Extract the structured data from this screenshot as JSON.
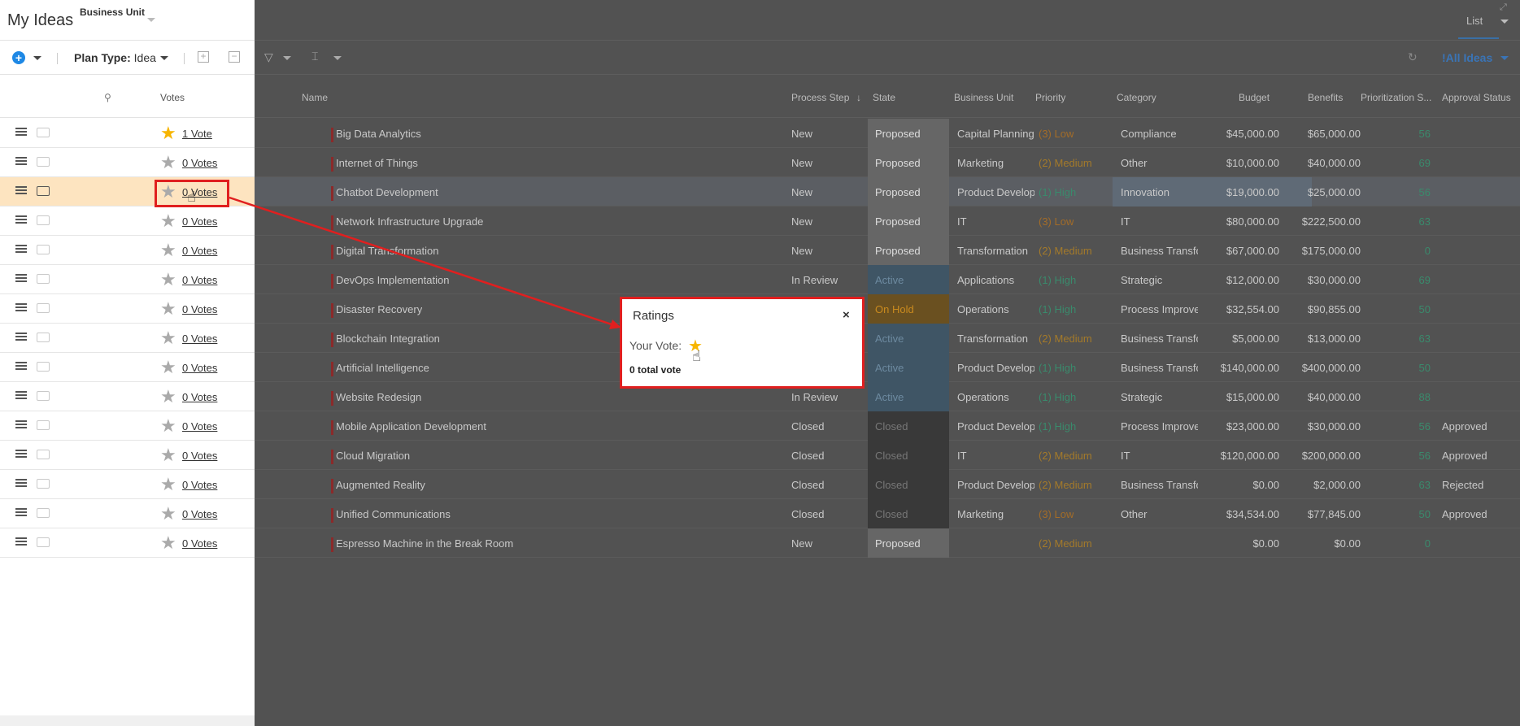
{
  "header": {
    "title": "My Ideas",
    "business_unit_label": "Business Unit",
    "view_tab": "List",
    "view_selector": "!All Ideas"
  },
  "toolbar": {
    "plan_type_label": "Plan Type:",
    "plan_type_value": "Idea"
  },
  "columns": {
    "votes": "Votes",
    "name": "Name",
    "process_step": "Process Step",
    "state": "State",
    "business_unit": "Business Unit",
    "priority": "Priority",
    "category": "Category",
    "budget": "Budget",
    "benefits": "Benefits",
    "prioritization": "Prioritization S...",
    "approval_status": "Approval Status"
  },
  "rows": [
    {
      "votes": "1 Vote",
      "voted": true,
      "name": "Big Data Analytics",
      "step": "New",
      "state": "Proposed",
      "bu": "Capital Planning",
      "priority": "(3) Low",
      "category": "Compliance",
      "budget": "$45,000.00",
      "benefits": "$65,000.00",
      "score": "56",
      "approval": ""
    },
    {
      "votes": "0 Votes",
      "voted": false,
      "name": "Internet of Things",
      "step": "New",
      "state": "Proposed",
      "bu": "Marketing",
      "priority": "(2) Medium",
      "category": "Other",
      "budget": "$10,000.00",
      "benefits": "$40,000.00",
      "score": "69",
      "approval": ""
    },
    {
      "votes": "0 Votes",
      "voted": false,
      "name": "Chatbot Development",
      "step": "New",
      "state": "Proposed",
      "bu": "Product Develop",
      "priority": "(1) High",
      "category": "Innovation",
      "budget": "$19,000.00",
      "benefits": "$25,000.00",
      "score": "56",
      "approval": ""
    },
    {
      "votes": "0 Votes",
      "voted": false,
      "name": "Network Infrastructure Upgrade",
      "step": "New",
      "state": "Proposed",
      "bu": "IT",
      "priority": "(3) Low",
      "category": "IT",
      "budget": "$80,000.00",
      "benefits": "$222,500.00",
      "score": "63",
      "approval": ""
    },
    {
      "votes": "0 Votes",
      "voted": false,
      "name": "Digital Transformation",
      "step": "New",
      "state": "Proposed",
      "bu": "Transformation",
      "priority": "(2) Medium",
      "category": "Business Transfo",
      "budget": "$67,000.00",
      "benefits": "$175,000.00",
      "score": "0",
      "approval": ""
    },
    {
      "votes": "0 Votes",
      "voted": false,
      "name": "DevOps Implementation",
      "step": "In Review",
      "state": "Active",
      "bu": "Applications",
      "priority": "(1) High",
      "category": "Strategic",
      "budget": "$12,000.00",
      "benefits": "$30,000.00",
      "score": "69",
      "approval": ""
    },
    {
      "votes": "0 Votes",
      "voted": false,
      "name": "Disaster Recovery",
      "step": "",
      "state": "On Hold",
      "bu": "Operations",
      "priority": "(1) High",
      "category": "Process Improve",
      "budget": "$32,554.00",
      "benefits": "$90,855.00",
      "score": "50",
      "approval": ""
    },
    {
      "votes": "0 Votes",
      "voted": false,
      "name": "Blockchain Integration",
      "step": "",
      "state": "Active",
      "bu": "Transformation",
      "priority": "(2) Medium",
      "category": "Business Transfo",
      "budget": "$5,000.00",
      "benefits": "$13,000.00",
      "score": "63",
      "approval": ""
    },
    {
      "votes": "0 Votes",
      "voted": false,
      "name": "Artificial Intelligence",
      "step": "",
      "state": "Active",
      "bu": "Product Develop",
      "priority": "(1) High",
      "category": "Business Transfo",
      "budget": "$140,000.00",
      "benefits": "$400,000.00",
      "score": "50",
      "approval": ""
    },
    {
      "votes": "0 Votes",
      "voted": false,
      "name": "Website Redesign",
      "step": "In Review",
      "state": "Active",
      "bu": "Operations",
      "priority": "(1) High",
      "category": "Strategic",
      "budget": "$15,000.00",
      "benefits": "$40,000.00",
      "score": "88",
      "approval": ""
    },
    {
      "votes": "0 Votes",
      "voted": false,
      "name": "Mobile Application Development",
      "step": "Closed",
      "state": "Closed",
      "bu": "Product Develop",
      "priority": "(1) High",
      "category": "Process Improve",
      "budget": "$23,000.00",
      "benefits": "$30,000.00",
      "score": "56",
      "approval": "Approved"
    },
    {
      "votes": "0 Votes",
      "voted": false,
      "name": "Cloud Migration",
      "step": "Closed",
      "state": "Closed",
      "bu": "IT",
      "priority": "(2) Medium",
      "category": "IT",
      "budget": "$120,000.00",
      "benefits": "$200,000.00",
      "score": "56",
      "approval": "Approved"
    },
    {
      "votes": "0 Votes",
      "voted": false,
      "name": "Augmented Reality",
      "step": "Closed",
      "state": "Closed",
      "bu": "Product Develop",
      "priority": "(2) Medium",
      "category": "Business Transfo",
      "budget": "$0.00",
      "benefits": "$2,000.00",
      "score": "63",
      "approval": "Rejected"
    },
    {
      "votes": "0 Votes",
      "voted": false,
      "name": "Unified Communications",
      "step": "Closed",
      "state": "Closed",
      "bu": "Marketing",
      "priority": "(3) Low",
      "category": "Other",
      "budget": "$34,534.00",
      "benefits": "$77,845.00",
      "score": "50",
      "approval": "Approved"
    },
    {
      "votes": "0 Votes",
      "voted": false,
      "name": "Espresso Machine in the Break Room",
      "step": "New",
      "state": "Proposed",
      "bu": "",
      "priority": "(2) Medium",
      "category": "",
      "budget": "$0.00",
      "benefits": "$0.00",
      "score": "0",
      "approval": ""
    }
  ],
  "selected_row": 2,
  "popup": {
    "title": "Ratings",
    "close": "×",
    "your_vote_label": "Your Vote:",
    "total": "0 total vote"
  },
  "colors": {
    "accent": "#1e88e5",
    "highlight_red": "#e01f1f",
    "star_gold": "#f7b500",
    "selected_row": "#fde4c0"
  }
}
